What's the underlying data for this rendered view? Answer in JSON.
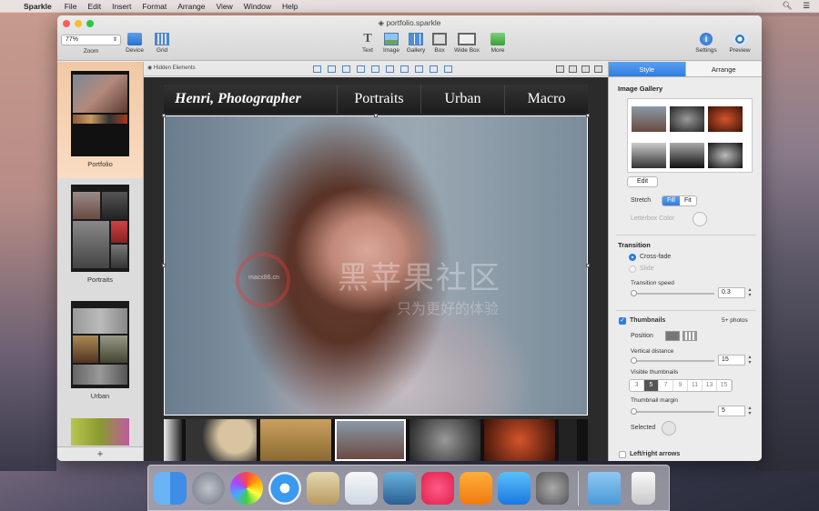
{
  "menubar": {
    "app_name": "Sparkle",
    "items": [
      "File",
      "Edit",
      "Insert",
      "Format",
      "Arrange",
      "View",
      "Window",
      "Help"
    ]
  },
  "window": {
    "title": "portfolio.sparkle",
    "zoom_value": "77%"
  },
  "toolbar": {
    "zoom_label": "Zoom",
    "device_label": "Device",
    "grid_label": "Grid",
    "text_label": "Text",
    "image_label": "Image",
    "gallery_label": "Gallery",
    "box_label": "Box",
    "widebox_label": "Wide Box",
    "more_label": "More",
    "settings_label": "Settings",
    "preview_label": "Preview"
  },
  "canvas_bar": {
    "hidden_elements_label": "Hidden Elements"
  },
  "pages": [
    {
      "label": "Portfolio",
      "selected": true
    },
    {
      "label": "Portraits",
      "selected": false
    },
    {
      "label": "Urban",
      "selected": false
    }
  ],
  "site": {
    "brand": "Henri, Photographer",
    "nav": [
      "Portraits",
      "Urban",
      "Macro"
    ]
  },
  "watermark": {
    "line1": "黑苹果社区",
    "line2": "只为更好的体验",
    "badge": "macx86.cn"
  },
  "inspector": {
    "tabs": [
      "Style",
      "Arrange"
    ],
    "image_gallery_title": "Image Gallery",
    "edit_label": "Edit",
    "stretch_label": "Stretch",
    "stretch_options": [
      "Fill",
      "Fit"
    ],
    "letterbox_label": "Letterbox Color",
    "transition_title": "Transition",
    "crossfade_label": "Cross-fade",
    "slide_label": "Slide",
    "transition_speed_label": "Transition speed",
    "transition_speed_value": "0.3",
    "thumbnails_label": "Thumbnails",
    "thumbnails_count": "5+ photos",
    "position_label": "Position",
    "vertical_distance_label": "Vertical distance",
    "vertical_distance_value": "15",
    "visible_thumbnails_label": "Visible thumbnails",
    "visible_thumbnail_options": [
      "3",
      "5",
      "7",
      "9",
      "11",
      "13",
      "15"
    ],
    "thumbnail_margin_label": "Thumbnail margin",
    "thumbnail_margin_value": "5",
    "selected_label": "Selected",
    "lr_arrows_label": "Left/right arrows"
  },
  "colors": {
    "accent": "#2f7de0",
    "selection_page": "#f6d2b3"
  }
}
